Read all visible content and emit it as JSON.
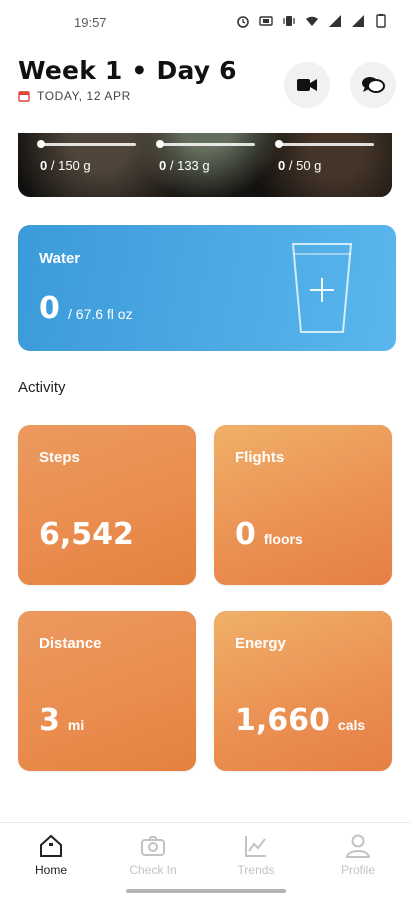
{
  "status_bar": {
    "time": "19:57"
  },
  "header": {
    "title": "Week 1 • Day 6",
    "date": "TODAY, 12 APR"
  },
  "macros": [
    {
      "current": "0",
      "goal": "/ 150 g",
      "progress": 0
    },
    {
      "current": "0",
      "goal": "/ 133 g",
      "progress": 0
    },
    {
      "current": "0",
      "goal": "/ 50 g",
      "progress": 0
    }
  ],
  "water": {
    "title": "Water",
    "value": "0",
    "goal": "/ 67.6 fl oz"
  },
  "activity": {
    "title": "Activity",
    "cards": [
      {
        "label": "Steps",
        "value": "6,542",
        "unit": ""
      },
      {
        "label": "Flights",
        "value": "0",
        "unit": "floors"
      },
      {
        "label": "Distance",
        "value": "3",
        "unit": "mi"
      },
      {
        "label": "Energy",
        "value": "1,660",
        "unit": "cals"
      }
    ]
  },
  "nav": {
    "items": [
      {
        "label": "Home",
        "icon": "home-icon",
        "active": true
      },
      {
        "label": "Check In",
        "icon": "camera-icon",
        "active": false
      },
      {
        "label": "Trends",
        "icon": "trends-icon",
        "active": false
      },
      {
        "label": "Profile",
        "icon": "profile-icon",
        "active": false
      }
    ]
  },
  "colors": {
    "water_card": "#4aa8e2",
    "activity_card": "#e98e50",
    "active_nav": "#222222",
    "inactive_nav": "#c3c3c3"
  }
}
